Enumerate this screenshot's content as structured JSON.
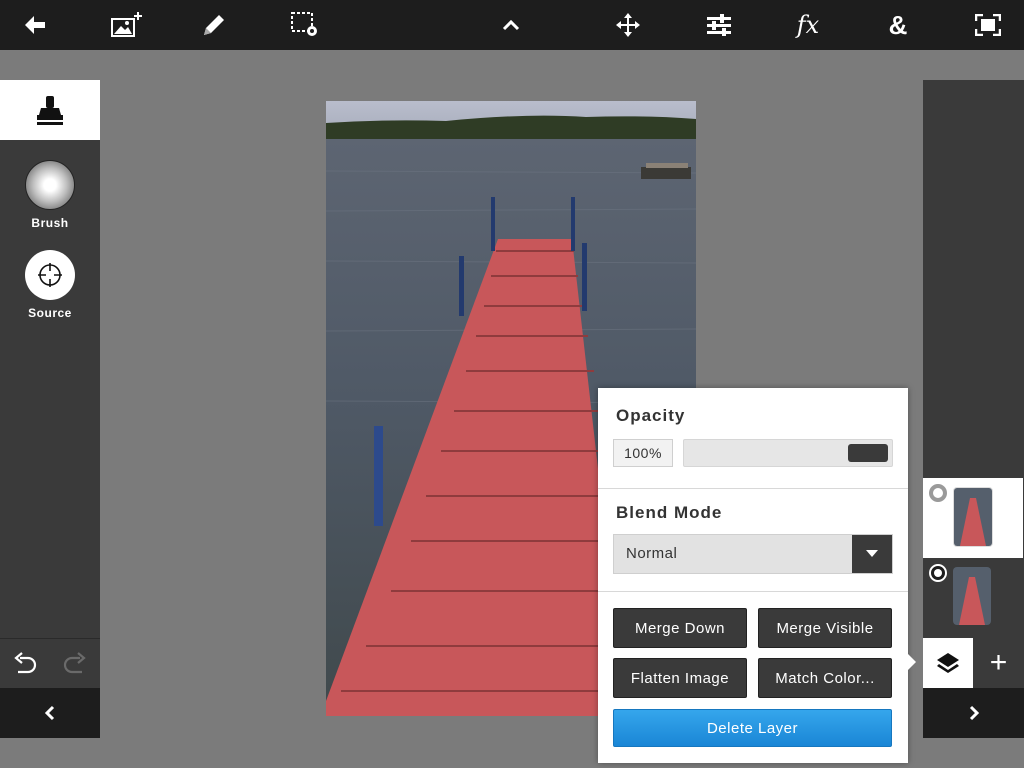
{
  "toolbar": {
    "icons": [
      "back-arrow-icon",
      "add-image-icon",
      "pencil-icon",
      "selection-settings-icon",
      "chevron-up-icon",
      "move-icon",
      "adjustments-icon",
      "fx-icon",
      "ampersand-icon",
      "fit-screen-icon"
    ],
    "fx_label": "fx",
    "amp_label": "&"
  },
  "left_panel": {
    "active_tool_icon": "clone-stamp-icon",
    "brush_label": "Brush",
    "source_label": "Source",
    "undo_icon": "undo-icon",
    "redo_icon": "redo-icon",
    "collapse_icon": "chevron-left-icon"
  },
  "popover": {
    "opacity_heading": "Opacity",
    "opacity_value": "100%",
    "opacity_level": 1.0,
    "blend_heading": "Blend Mode",
    "blend_value": "Normal",
    "merge_down": "Merge Down",
    "merge_visible": "Merge Visible",
    "flatten_image": "Flatten Image",
    "match_color": "Match Color...",
    "delete_layer": "Delete Layer"
  },
  "right_panel": {
    "layers": [
      {
        "selected": false,
        "active": true
      },
      {
        "selected": true,
        "active": false
      }
    ],
    "layers_icon": "layers-icon",
    "add_label": "+",
    "collapse_icon": "chevron-right-icon"
  },
  "colors": {
    "accent_blue": "#1a86d6",
    "dock_red": "#c8575a",
    "bar_dark": "#1d1d1d",
    "panel": "#3a3a3a"
  }
}
